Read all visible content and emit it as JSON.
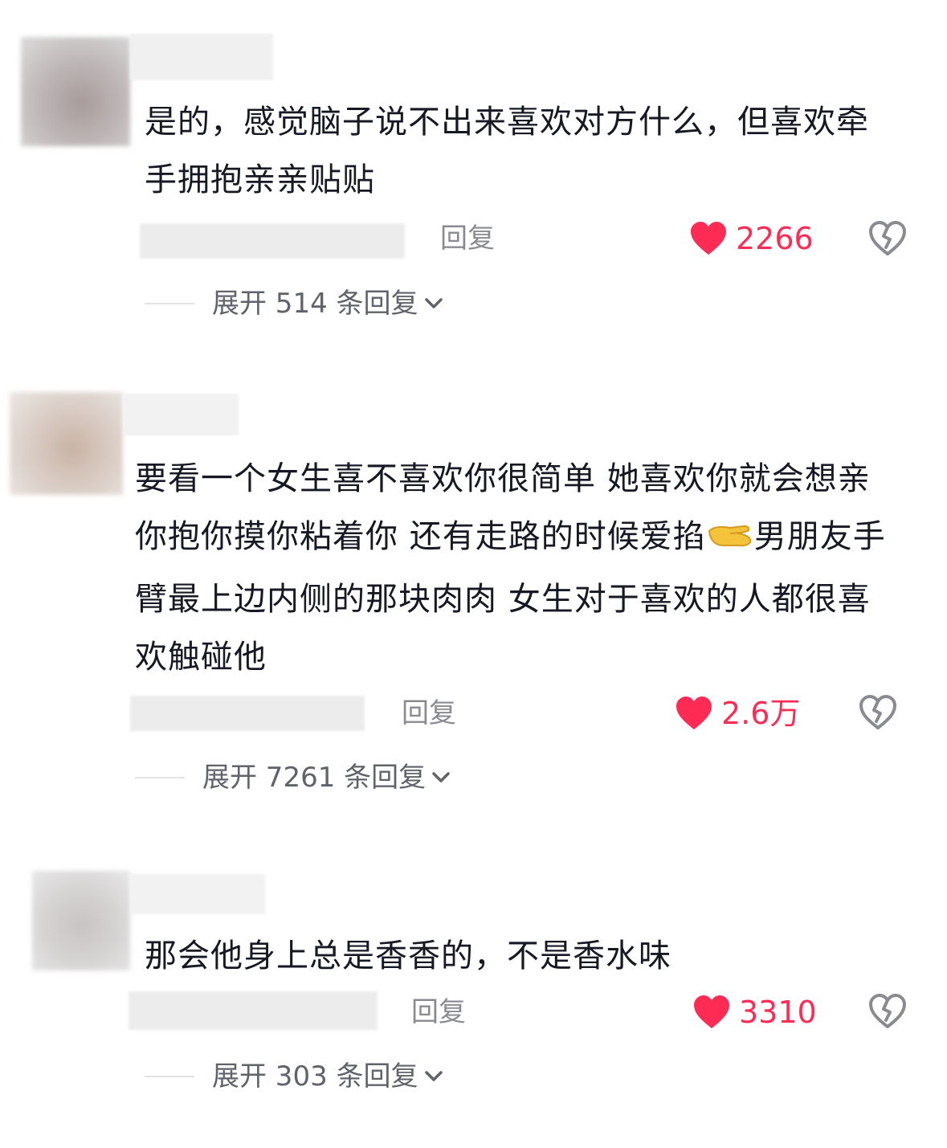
{
  "comments": [
    {
      "text": "是的，感觉脑子说不出来喜欢对方什么，但喜欢牵手拥抱亲亲贴贴",
      "reply_label": "回复",
      "likes": "2266",
      "expand_label": "展开 514 条回复"
    },
    {
      "text": "要看一个女生喜不喜欢你很简单 她喜欢你就会想亲你抱你摸你粘着你 还有走路的时候爱掐",
      "text_after_emoji": "男朋友手臂最上边内侧的那块肉肉 女生对于喜欢的人都很喜欢触碰他",
      "emoji": "pinching-hand-emoji",
      "reply_label": "回复",
      "likes": "2.6万",
      "expand_label": "展开 7261 条回复"
    },
    {
      "text": "那会他身上总是香香的，不是香水味",
      "reply_label": "回复",
      "likes": "3310",
      "expand_label": "展开 303 条回复"
    }
  ],
  "colors": {
    "like": "#fe2c55",
    "text": "#161823",
    "muted": "#8a8b91",
    "expand": "#61636b"
  },
  "icons": [
    "heart-filled-icon",
    "broken-heart-icon",
    "chevron-down-icon"
  ]
}
